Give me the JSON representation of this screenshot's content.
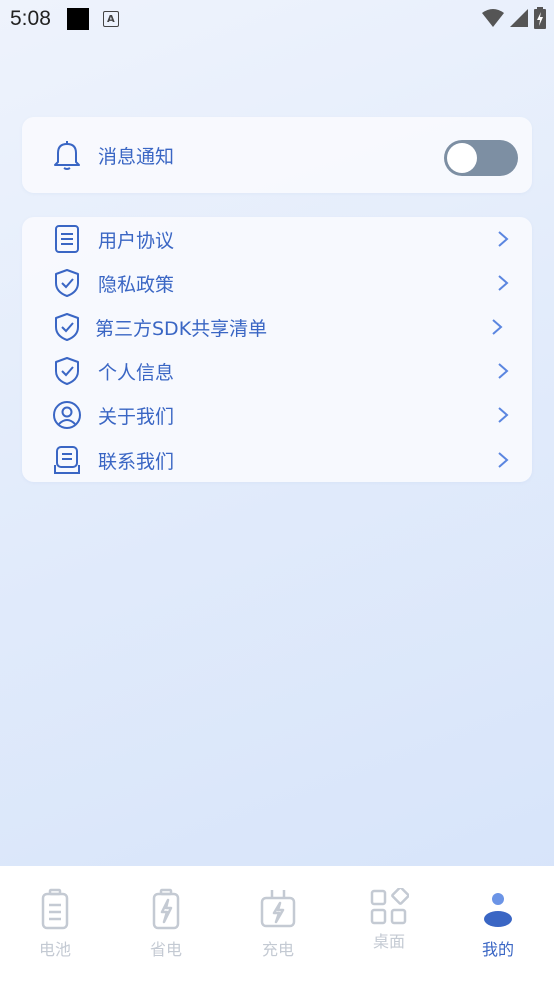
{
  "status_bar": {
    "time": "5:08"
  },
  "notification": {
    "label": "消息通知",
    "enabled": false
  },
  "menu": [
    {
      "label": "用户协议",
      "icon": "document-icon"
    },
    {
      "label": "隐私政策",
      "icon": "shield-check-icon"
    },
    {
      "label": "第三方SDK共享清单",
      "icon": "shield-check-icon"
    },
    {
      "label": "个人信息",
      "icon": "shield-check-icon"
    },
    {
      "label": "关于我们",
      "icon": "user-circle-icon"
    },
    {
      "label": "联系我们",
      "icon": "contact-icon"
    }
  ],
  "bottom_nav": [
    {
      "label": "电池",
      "icon": "battery-icon",
      "active": false
    },
    {
      "label": "省电",
      "icon": "battery-bolt-icon",
      "active": false
    },
    {
      "label": "充电",
      "icon": "charger-icon",
      "active": false
    },
    {
      "label": "桌面",
      "icon": "apps-grid-icon",
      "active": false
    },
    {
      "label": "我的",
      "icon": "person-icon",
      "active": true
    }
  ],
  "colors": {
    "accent": "#3a66c4",
    "inactive": "#c4cad3",
    "toggle_off": "#7d8fa3"
  }
}
